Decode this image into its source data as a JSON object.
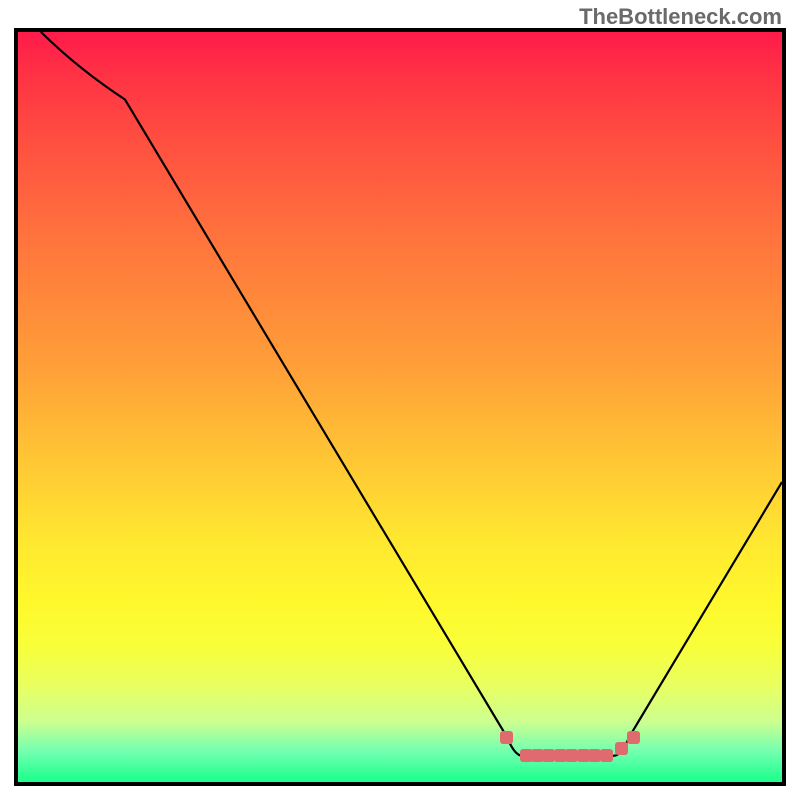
{
  "watermark": "TheBottleneck.com",
  "chart_data": {
    "type": "line",
    "title": "",
    "xlabel": "",
    "ylabel": "",
    "xlim": [
      0,
      100
    ],
    "ylim": [
      0,
      100
    ],
    "series": [
      {
        "name": "curve",
        "x": [
          3,
          8,
          14,
          64,
          66,
          78,
          80,
          100
        ],
        "y": [
          100,
          95,
          91,
          6,
          3.5,
          3.5,
          6,
          40
        ]
      }
    ],
    "markers": {
      "name": "highlight-points",
      "color": "#df6b6f",
      "points": [
        {
          "x": 64,
          "y": 6
        },
        {
          "x": 66.5,
          "y": 3.5
        },
        {
          "x": 68,
          "y": 3.5
        },
        {
          "x": 69.5,
          "y": 3.5
        },
        {
          "x": 71,
          "y": 3.5
        },
        {
          "x": 72.5,
          "y": 3.5
        },
        {
          "x": 74,
          "y": 3.5
        },
        {
          "x": 75.5,
          "y": 3.5
        },
        {
          "x": 77,
          "y": 3.5
        },
        {
          "x": 79,
          "y": 4.5
        },
        {
          "x": 80.5,
          "y": 6
        }
      ]
    },
    "background_gradient": {
      "top": "#ff1a4a",
      "mid": "#ffe830",
      "bottom": "#1aff8a"
    }
  }
}
